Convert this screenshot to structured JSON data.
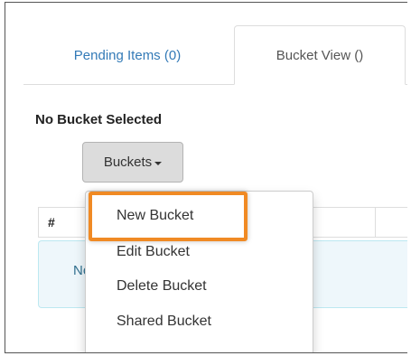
{
  "tabs": [
    {
      "label": "Pending Items (0)",
      "active": false
    },
    {
      "label": "Bucket View ()",
      "active": true
    }
  ],
  "heading": "No Bucket Selected",
  "buckets_button": {
    "label": "Buckets"
  },
  "table": {
    "columns": [
      "#"
    ]
  },
  "info_box": {
    "text": "No"
  },
  "dropdown": {
    "items": [
      {
        "label": "New Bucket",
        "highlighted": true
      },
      {
        "label": "Edit Bucket"
      },
      {
        "label": "Delete Bucket"
      },
      {
        "label": "Shared Bucket"
      }
    ]
  },
  "colors": {
    "tab_link": "#337ab7",
    "info_bg": "#eef7fb",
    "info_text": "#31708f",
    "highlight": "#f08a24"
  }
}
